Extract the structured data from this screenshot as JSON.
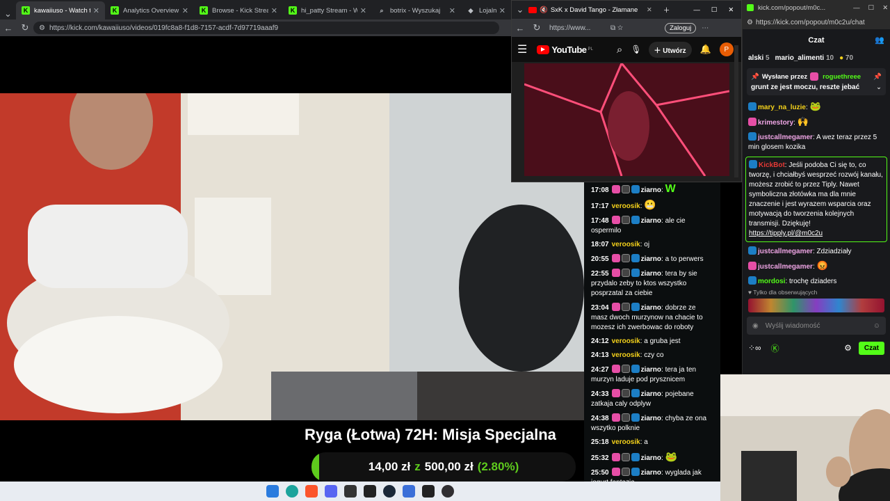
{
  "main_tabs": [
    {
      "label": "kawaiiuso - Watch the VO",
      "favicon": "kick-icon"
    },
    {
      "label": "Analytics Overview - Kick",
      "favicon": "kick-icon"
    },
    {
      "label": "Browse - Kick Streaming",
      "favicon": "kick-icon"
    },
    {
      "label": "hi_patty Stream - Watch",
      "favicon": "kick-icon"
    },
    {
      "label": "botrix - Wyszukaj",
      "favicon": "search-icon"
    },
    {
      "label": "Lojalność | N",
      "favicon": "shield-icon"
    }
  ],
  "main_url": "https://kick.com/kawaiiuso/videos/019fc8a8-f1d8-7157-acdf-7d97719aaaf9",
  "overlay": {
    "title": "Ryga (Łotwa) 72H: Misja Specjalna",
    "amount_current": "14,00 zł",
    "amount_sep": "z",
    "amount_goal": "500,00 zł",
    "percent_text": "(2.80%)",
    "progress": 0.028
  },
  "vod_chat": [
    {
      "time": "17:08",
      "user": "ziarno",
      "user_color": "#ffffff",
      "badges": [
        "pink",
        "gray",
        "blue"
      ],
      "text": "",
      "emote": "W"
    },
    {
      "time": "17:17",
      "user": "veroosik",
      "user_color": "#f5d21b",
      "badges": [],
      "text": "",
      "emote": "😬"
    },
    {
      "time": "17:48",
      "user": "ziarno",
      "user_color": "#ffffff",
      "badges": [
        "pink",
        "gray",
        "blue"
      ],
      "text": "ale cie ospermilo"
    },
    {
      "time": "18:07",
      "user": "veroosik",
      "user_color": "#f5d21b",
      "badges": [],
      "text": "oj"
    },
    {
      "time": "20:55",
      "user": "ziarno",
      "user_color": "#ffffff",
      "badges": [
        "pink",
        "gray",
        "blue"
      ],
      "text": "a to perwers"
    },
    {
      "time": "22:55",
      "user": "ziarno",
      "user_color": "#ffffff",
      "badges": [
        "pink",
        "gray",
        "blue"
      ],
      "text": "tera by sie przydalo zeby to ktos wszystko posprzatal za ciebie"
    },
    {
      "time": "23:04",
      "user": "ziarno",
      "user_color": "#ffffff",
      "badges": [
        "pink",
        "gray",
        "blue"
      ],
      "text": "dobrze ze masz dwoch murzynow na chacie to mozesz ich zwerbowac do roboty"
    },
    {
      "time": "24:12",
      "user": "veroosik",
      "user_color": "#f5d21b",
      "badges": [],
      "text": "a gruba jest"
    },
    {
      "time": "24:13",
      "user": "veroosik",
      "user_color": "#f5d21b",
      "badges": [],
      "text": "czy co"
    },
    {
      "time": "24:27",
      "user": "ziarno",
      "user_color": "#ffffff",
      "badges": [
        "pink",
        "gray",
        "blue"
      ],
      "text": "tera ja ten murzyn laduje pod prysznicem"
    },
    {
      "time": "24:33",
      "user": "ziarno",
      "user_color": "#ffffff",
      "badges": [
        "pink",
        "gray",
        "blue"
      ],
      "text": "pojebane zatkaja caly odplyw"
    },
    {
      "time": "24:38",
      "user": "ziarno",
      "user_color": "#ffffff",
      "badges": [
        "pink",
        "gray",
        "blue"
      ],
      "text": "chyba ze ona wszytko polknie"
    },
    {
      "time": "25:18",
      "user": "veroosik",
      "user_color": "#f5d21b",
      "badges": [],
      "text": "a"
    },
    {
      "time": "25:32",
      "user": "ziarno",
      "user_color": "#ffffff",
      "badges": [
        "pink",
        "gray",
        "blue"
      ],
      "text": "",
      "emote": "🐸"
    },
    {
      "time": "25:50",
      "user": "ziarno",
      "user_color": "#ffffff",
      "badges": [
        "pink",
        "gray",
        "blue"
      ],
      "text": "wyglada jak jogurt fantazja"
    }
  ],
  "yt": {
    "tab_title": "SxK x David Tango - Złamane",
    "url": "https://www...",
    "login_label": "Zaloguj",
    "logo_text": "YouTube",
    "region": "PL",
    "create_label": "Utwórz",
    "avatar_letter": "P"
  },
  "popout": {
    "top_url": "kick.com/popout/m0c...",
    "address": "https://kick.com/popout/m0c2u/chat",
    "header": "Czat",
    "leaderboard": [
      {
        "name": "alski",
        "count": "5"
      },
      {
        "name": "mario_alimenti",
        "count": "10"
      },
      {
        "name": "",
        "count": "70"
      }
    ],
    "pinned_label": "Wysłane przez",
    "pinned_user": "roguethreee",
    "pinned_text": "grunt ze jest moczu, reszte jebać",
    "messages": [
      {
        "user": "mary_na_luzie",
        "color": "#f5d21b",
        "text": "",
        "emote": "🐸"
      },
      {
        "user": "krimestory",
        "color": "#f0a6e6",
        "text": "",
        "emote": "🙌"
      },
      {
        "user": "justcallmegamer",
        "color": "#f0a6e6",
        "text": "A wez teraz przez 5 min glosem kozika"
      },
      {
        "user": "KickBot",
        "color": "#e53935",
        "text": "Jeśli podoba Ci się to, co tworzę, i chciałbyś wesprzeć rozwój kanału, możesz zrobić to przez Tiply. Nawet symboliczna złotówka ma dla mnie znaczenie i jest wyrazem wsparcia oraz motywacją do tworzenia kolejnych transmisji. Dziękuję!",
        "link": "https://tipply.pl/@m0c2u",
        "highlight": true
      },
      {
        "user": "justcallmegamer",
        "color": "#f0a6e6",
        "text": "Zdziadziały"
      },
      {
        "user": "justcallmegamer",
        "color": "#f0a6e6",
        "text": "",
        "emote": "😡"
      },
      {
        "user": "mordosi",
        "color": "#53fc18",
        "text": "trochę dziaders"
      }
    ],
    "followers_only": "Tylko dla obserwujących",
    "input_placeholder": "Wyślij wiadomość",
    "send_label": "Czat"
  }
}
